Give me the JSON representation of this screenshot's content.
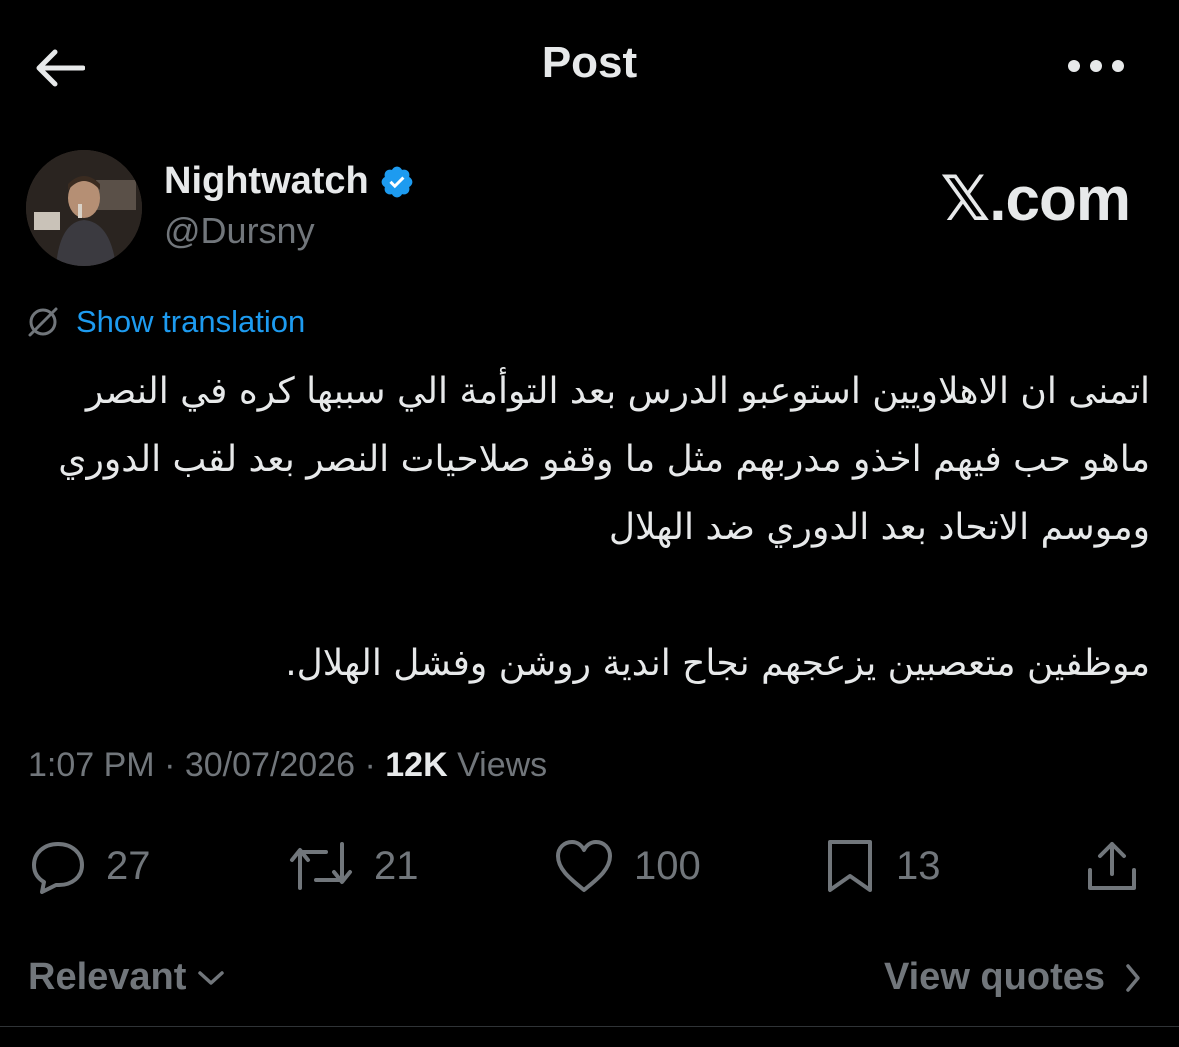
{
  "header": {
    "title": "Post",
    "back_icon": "arrow-left-icon",
    "more_icon": "ellipsis-icon"
  },
  "author": {
    "display_name": "Nightwatch",
    "handle": "@Dursny",
    "verified_icon": "verified-badge-icon",
    "verified_color": "#1d9bf0"
  },
  "watermark": "𝕏.com",
  "translation": {
    "label": "Show translation",
    "icon": "translate-icon",
    "color": "#1d9bf0"
  },
  "tweet": {
    "paragraph_1": "اتمنى ان الاهلاويين استوعبو الدرس بعد التوأمة الي سببها كره في النصر ماهو حب فيهم اخذو مدربهم مثل ما وقفو صلاحيات النصر بعد لقب الدوري وموسم الاتحاد بعد الدوري ضد الهلال",
    "paragraph_2": "موظفين متعصبين يزعجهم نجاح اندية روشن وفشل الهلال."
  },
  "meta": {
    "time": "1:07 PM",
    "separator": "·",
    "date": "30/07/2026",
    "views_count": "12K",
    "views_label": "Views"
  },
  "actions": {
    "replies": "27",
    "reposts": "21",
    "likes": "100",
    "bookmarks": "13"
  },
  "footer": {
    "sort_label": "Relevant",
    "quotes_label": "View quotes"
  },
  "colors": {
    "background": "#000000",
    "text_primary": "#e7e9ea",
    "text_secondary": "#71767b",
    "accent": "#1d9bf0"
  }
}
